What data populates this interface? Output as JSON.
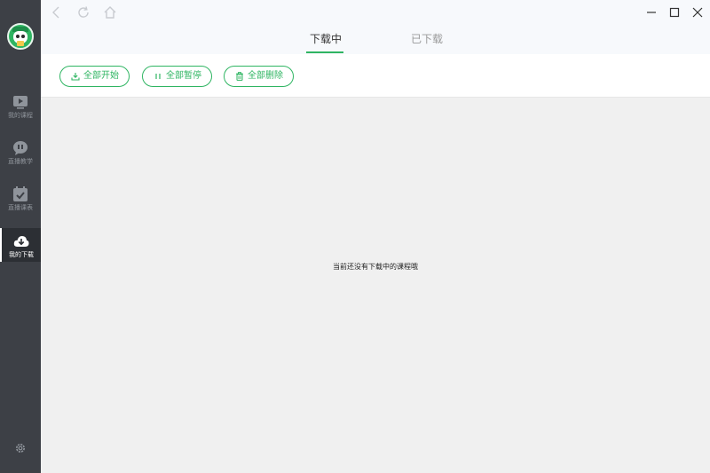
{
  "sidebar": {
    "items": [
      {
        "label": "我的课程",
        "icon": "play-video-icon"
      },
      {
        "label": "直播教学",
        "icon": "chat-bubble-icon"
      },
      {
        "label": "直播课表",
        "icon": "checklist-icon"
      },
      {
        "label": "我的下载",
        "icon": "cloud-download-icon"
      }
    ],
    "settings_icon": "gear-icon"
  },
  "tabs": [
    {
      "label": "下载中",
      "active": true
    },
    {
      "label": "已下载",
      "active": false
    }
  ],
  "toolbar": {
    "start_all": "全部开始",
    "pause_all": "全部暂停",
    "delete_all": "全部删除"
  },
  "content": {
    "empty_message": "当前还没有下载中的课程哦"
  },
  "colors": {
    "accent": "#2fb562",
    "sidebar_bg": "#3d4046",
    "content_bg": "#f0f0f0"
  }
}
